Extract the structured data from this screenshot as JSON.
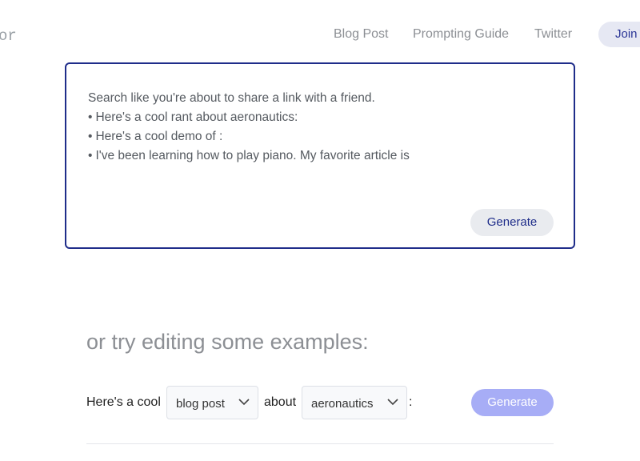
{
  "logo_fragment": "or",
  "nav": {
    "links": [
      "Blog Post",
      "Prompting Guide",
      "Twitter"
    ],
    "join_label": "Join"
  },
  "search": {
    "lines": [
      "Search like you're about to share a link with a friend.",
      "Here's a cool rant about aeronautics:",
      "Here's a cool demo of :",
      "I've been learning how to play piano. My favorite article is"
    ],
    "bullet": "•",
    "generate_label": "Generate"
  },
  "examples": {
    "heading": "or try editing some examples:",
    "prefix": "Here's a cool",
    "select1_value": "blog post",
    "middle": "about",
    "select2_value": "aeronautics",
    "suffix": ":",
    "generate_label": "Generate"
  }
}
